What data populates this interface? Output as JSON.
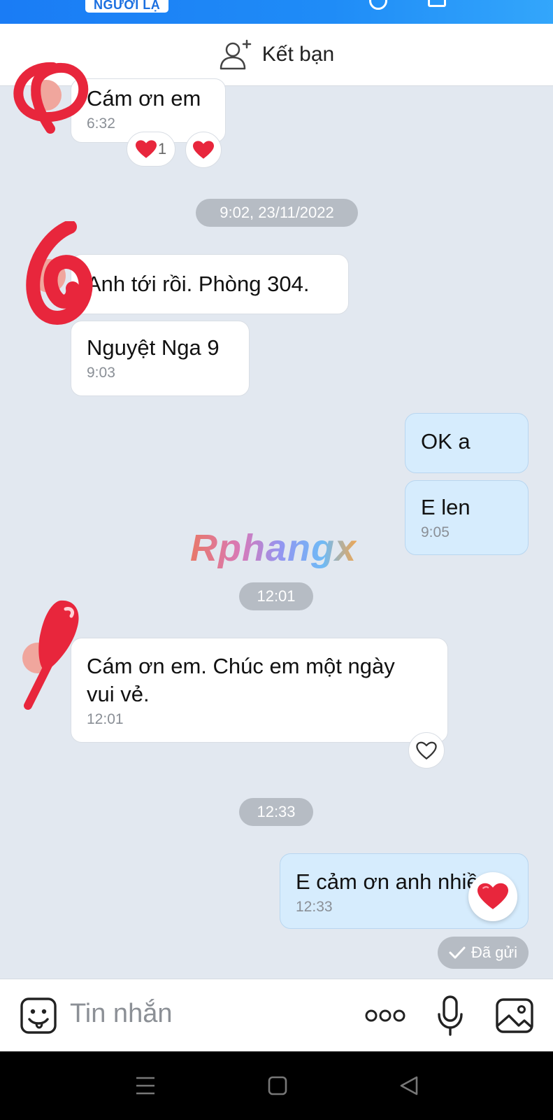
{
  "header": {
    "stranger_badge": "NGƯỜI LẠ"
  },
  "friend_bar": {
    "label": "Kết bạn",
    "icon": "add-friend-icon"
  },
  "messages": [
    {
      "side": "them",
      "text": "Cám ơn em",
      "time": "6:32"
    },
    {
      "side": "them",
      "text": "Anh tới rồi. Phòng 304.",
      "time": ""
    },
    {
      "side": "them",
      "text": "Nguyệt Nga 9",
      "time": "9:03"
    },
    {
      "side": "me",
      "text": "OK a",
      "time": ""
    },
    {
      "side": "me",
      "text": "E len",
      "time": "9:05"
    },
    {
      "side": "them",
      "text": "Cám ơn em. Chúc em một ngày\nvui vẻ.",
      "time": "12:01"
    },
    {
      "side": "me",
      "text": "E cảm ơn anh nhiều!",
      "time": "12:33"
    }
  ],
  "reactions": {
    "first_count": "1"
  },
  "dividers": {
    "d1": "9:02, 23/11/2022",
    "d2": "12:01",
    "d3": "12:33"
  },
  "watermark": "Rphangx",
  "status": {
    "sent": "Đã gửi"
  },
  "composer": {
    "placeholder": "Tin nhắn"
  },
  "colors": {
    "header_blue": "#1f8cf7",
    "my_bubble": "#d6ecfd",
    "heart": "#e8263c"
  }
}
